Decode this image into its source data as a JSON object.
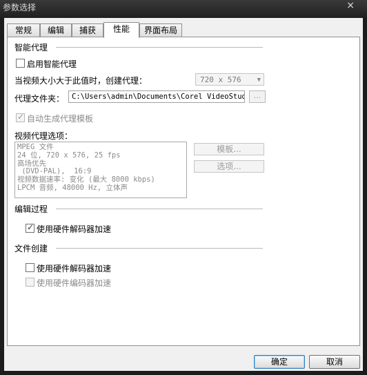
{
  "window": {
    "title": "参数选择",
    "close_label": "×"
  },
  "tabs": [
    {
      "label": "常规"
    },
    {
      "label": "编辑"
    },
    {
      "label": "捕获"
    },
    {
      "label": "性能"
    },
    {
      "label": "界面布局"
    }
  ],
  "smart_proxy": {
    "section_title": "智能代理",
    "enable_label": "启用智能代理",
    "threshold_label": "当视频大小大于此值时，创建代理：",
    "threshold_value": "720 x 576",
    "folder_label": "代理文件夹：",
    "folder_value": "C:\\Users\\admin\\Documents\\Corel VideoStudio",
    "browse_label": "...",
    "auto_template_label": "自动生成代理模板",
    "options_label": "视频代理选项：",
    "options_lines": [
      "MPEG 文件",
      "24 位, 720 x 576, 25 fps",
      "高场优先",
      " (DVD-PAL),  16:9",
      "视频数据速率: 变化 (最大  8000 kbps)",
      "LPCM 音频, 48000 Hz, 立体声"
    ],
    "template_button": "模板...",
    "options_button": "选项..."
  },
  "edit_process": {
    "section_title": "编辑过程",
    "hw_decoder_label": "使用硬件解码器加速"
  },
  "file_creation": {
    "section_title": "文件创建",
    "hw_decoder_label": "使用硬件解码器加速",
    "hw_encoder_label": "使用硬件编码器加速"
  },
  "footer": {
    "ok_label": "确定",
    "cancel_label": "取消"
  }
}
